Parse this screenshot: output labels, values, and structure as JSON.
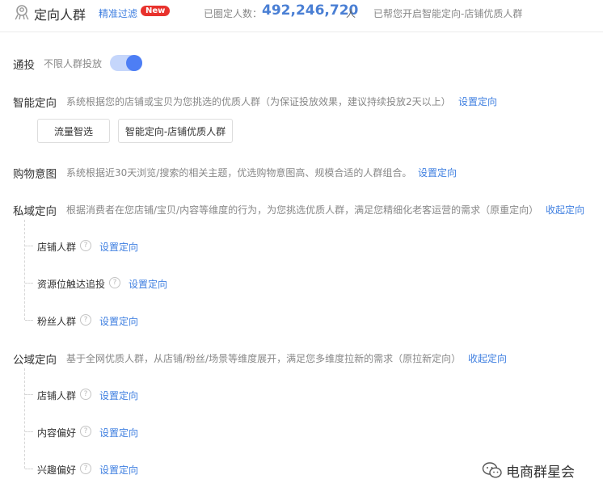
{
  "header": {
    "title": "定向人群",
    "filter_link": "精准过滤",
    "new_badge": "New",
    "count_label": "已圈定人数：",
    "count_value": "492,246,720",
    "count_unit": "人",
    "smart_note": "已帮您开启智能定向-店铺优质人群"
  },
  "general": {
    "label": "通投",
    "desc": "不限人群投放",
    "toggle_on": true,
    "toggle_color": "#4d7ef5"
  },
  "smart": {
    "label": "智能定向",
    "desc": "系统根据您的店铺或宝贝为您挑选的优质人群（为保证投放效果，建议持续投放2天以上）",
    "action": "设置定向",
    "chips": [
      "流量智选",
      "智能定向-店铺优质人群"
    ]
  },
  "shopping": {
    "label": "购物意图",
    "desc": "系统根据近30天浏览/搜索的相关主题，优选购物意图高、规模合适的人群组合。",
    "action": "设置定向"
  },
  "private": {
    "label": "私域定向",
    "desc": "根据消费者在您店铺/宝贝/内容等维度的行为，为您挑选优质人群，满足您精细化老客运营的需求（原重定向）",
    "action": "收起定向",
    "items": [
      {
        "label": "店铺人群",
        "action": "设置定向"
      },
      {
        "label": "资源位触达追投",
        "action": "设置定向"
      },
      {
        "label": "粉丝人群",
        "action": "设置定向"
      }
    ]
  },
  "public": {
    "label": "公域定向",
    "desc": "基于全网优质人群，从店铺/粉丝/场景等维度展开，满足您多维度拉新的需求（原拉新定向）",
    "action": "收起定向",
    "items": [
      {
        "label": "店铺人群",
        "action": "设置定向"
      },
      {
        "label": "内容偏好",
        "action": "设置定向"
      },
      {
        "label": "兴趣偏好",
        "action": "设置定向"
      }
    ]
  },
  "watermark": "电商群星会",
  "colors": {
    "accent": "#3f7fe0",
    "badge": "#e8322d",
    "count": "#4a7fd4"
  }
}
